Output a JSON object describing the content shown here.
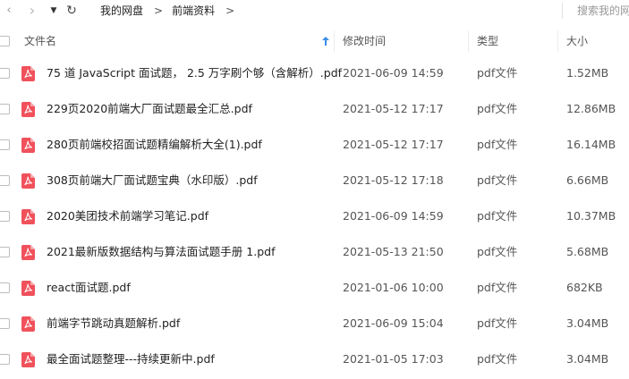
{
  "toolbar": {
    "breadcrumb": [
      "我的网盘",
      "前端资料"
    ],
    "breadcrumb_sep": ">",
    "search_placeholder": "搜索我的网盘"
  },
  "columns": {
    "name": "文件名",
    "modified": "修改时间",
    "type": "类型",
    "size": "大小"
  },
  "files": [
    {
      "name": "75 道 JavaScript 面试题， 2.5 万字刷个够（含解析）.pdf",
      "modified": "2021-06-09 14:59",
      "type": "pdf文件",
      "size": "1.52MB"
    },
    {
      "name": "229页2020前端大厂面试题最全汇总.pdf",
      "modified": "2021-05-12 17:17",
      "type": "pdf文件",
      "size": "12.86MB"
    },
    {
      "name": "280页前端校招面试题精编解析大全(1).pdf",
      "modified": "2021-05-12 17:17",
      "type": "pdf文件",
      "size": "16.14MB"
    },
    {
      "name": "308页前端大厂面试题宝典（水印版）.pdf",
      "modified": "2021-05-12 17:18",
      "type": "pdf文件",
      "size": "6.66MB"
    },
    {
      "name": "2020美团技术前端学习笔记.pdf",
      "modified": "2021-06-09 14:59",
      "type": "pdf文件",
      "size": "10.37MB"
    },
    {
      "name": "2021最新版数据结构与算法面试题手册 1.pdf",
      "modified": "2021-05-13 21:50",
      "type": "pdf文件",
      "size": "5.68MB"
    },
    {
      "name": "react面试题.pdf",
      "modified": "2021-01-06 10:00",
      "type": "pdf文件",
      "size": "682KB"
    },
    {
      "name": "前端字节跳动真题解析.pdf",
      "modified": "2021-06-09 15:04",
      "type": "pdf文件",
      "size": "3.04MB"
    },
    {
      "name": "最全面试题整理---持续更新中.pdf",
      "modified": "2021-01-05 17:03",
      "type": "pdf文件",
      "size": "3.04MB"
    }
  ],
  "colors": {
    "pdf_icon": "#f0515b",
    "sort_arrow": "#3b8ee8"
  }
}
